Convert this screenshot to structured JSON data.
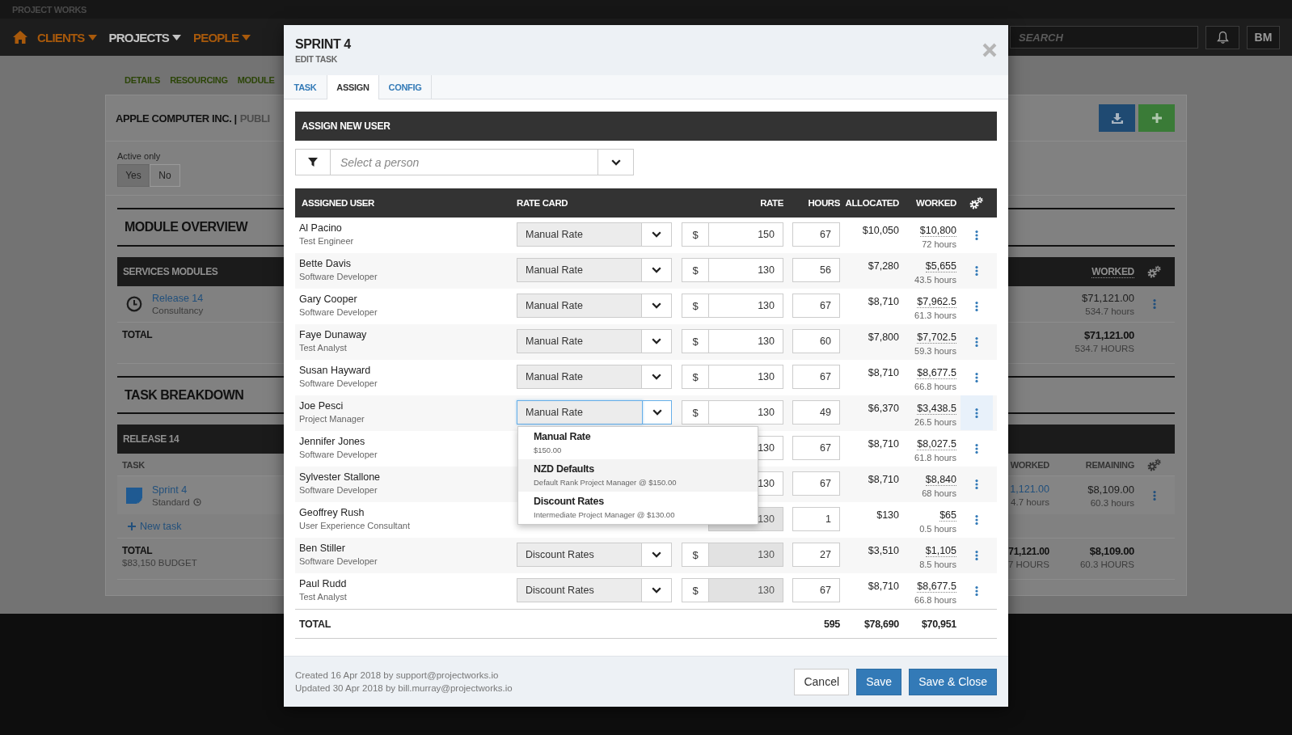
{
  "top_bar": {
    "brand": "PROJECT WORKS",
    "nav": [
      {
        "label": "CLIENTS",
        "selected": false
      },
      {
        "label": "PROJECTS",
        "selected": true
      },
      {
        "label": "PEOPLE",
        "selected": false
      }
    ],
    "search": {
      "placeholder": "SEARCH"
    },
    "user": "BM"
  },
  "page": {
    "tabs": [
      "DETAILS",
      "RESOURCING",
      "MODULE"
    ],
    "title": "APPLE COMPUTER INC. |",
    "subtitle": "PUBLI",
    "active_filter": {
      "label": "Active only",
      "options": [
        {
          "label": "Yes",
          "selected": true
        },
        {
          "label": "No",
          "selected": false
        }
      ]
    },
    "module_overview": {
      "title": "MODULE OVERVIEW",
      "group": "SERVICES MODULES",
      "column": "WORKED",
      "rows": [
        {
          "name": "Release 14",
          "type": "Consultancy",
          "worked": "$71,121.00",
          "hours": "534.7 hours"
        }
      ],
      "total": {
        "label": "TOTAL",
        "worked": "$71,121.00",
        "hours": "534.7 HOURS"
      }
    },
    "task_breakdown": {
      "title": "TASK BREAKDOWN",
      "group": "RELEASE 14",
      "columns": [
        "TASK",
        "WORKED",
        "REMAINING"
      ],
      "rows": [
        {
          "name": "Sprint 4",
          "type": "Standard",
          "worked": "1,121.00",
          "worked_hours": "4.7 hours",
          "remaining": "$8,109.00",
          "remaining_hours": "60.3 hours"
        }
      ],
      "new_task": "New task",
      "total": {
        "label": "TOTAL",
        "budget": "$83,150 BUDGET",
        "worked": "71,121.00",
        "worked_hours": "7 HOURS",
        "remaining": "$8,109.00",
        "remaining_hours": "60.3 HOURS"
      }
    }
  },
  "modal": {
    "title": "SPRINT 4",
    "subtitle": "EDIT TASK",
    "tabs": [
      {
        "label": "TASK",
        "selected": false
      },
      {
        "label": "ASSIGN",
        "selected": true
      },
      {
        "label": "CONFIG",
        "selected": false
      }
    ],
    "assign_title": "ASSIGN NEW USER",
    "person_select": {
      "placeholder": "Select a person"
    },
    "columns": [
      "ASSIGNED USER",
      "RATE CARD",
      "RATE",
      "HOURS",
      "ALLOCATED",
      "WORKED"
    ],
    "assignments": [
      {
        "name": "Al Pacino",
        "role": "Test Engineer",
        "rate_card": "Manual Rate",
        "open": false,
        "currency": "$",
        "rate": "150",
        "rate_locked": false,
        "hours": "67",
        "allocated": "$10,050",
        "worked": "$10,800",
        "worked_hours": "72 hours"
      },
      {
        "name": "Bette Davis",
        "role": "Software Developer",
        "rate_card": "Manual Rate",
        "open": false,
        "currency": "$",
        "rate": "130",
        "rate_locked": false,
        "hours": "56",
        "allocated": "$7,280",
        "worked": "$5,655",
        "worked_hours": "43.5 hours"
      },
      {
        "name": "Gary Cooper",
        "role": "Software Developer",
        "rate_card": "Manual Rate",
        "open": false,
        "currency": "$",
        "rate": "130",
        "rate_locked": false,
        "hours": "67",
        "allocated": "$8,710",
        "worked": "$7,962.5",
        "worked_hours": "61.3 hours"
      },
      {
        "name": "Faye Dunaway",
        "role": "Test Analyst",
        "rate_card": "Manual Rate",
        "open": false,
        "currency": "$",
        "rate": "130",
        "rate_locked": false,
        "hours": "60",
        "allocated": "$7,800",
        "worked": "$7,702.5",
        "worked_hours": "59.3 hours"
      },
      {
        "name": "Susan Hayward",
        "role": "Software Developer",
        "rate_card": "Manual Rate",
        "open": false,
        "currency": "$",
        "rate": "130",
        "rate_locked": false,
        "hours": "67",
        "allocated": "$8,710",
        "worked": "$8,677.5",
        "worked_hours": "66.8 hours"
      },
      {
        "name": "Joe Pesci",
        "role": "Project Manager",
        "rate_card": "Manual Rate",
        "open": true,
        "currency": "$",
        "rate": "130",
        "rate_locked": false,
        "hours": "49",
        "allocated": "$6,370",
        "worked": "$3,438.5",
        "worked_hours": "26.5 hours"
      },
      {
        "name": "Jennifer Jones",
        "role": "Software Developer",
        "rate": "130",
        "rate_locked": false,
        "hours": "67",
        "allocated": "$8,710",
        "worked": "$8,027.5",
        "worked_hours": "61.8 hours"
      },
      {
        "name": "Sylvester Stallone",
        "role": "Software Developer",
        "rate": "130",
        "rate_locked": false,
        "hours": "67",
        "allocated": "$8,710",
        "worked": "$8,840",
        "worked_hours": "68 hours"
      },
      {
        "name": "Geoffrey Rush",
        "role": "User Experience Consultant",
        "rate": "130",
        "rate_locked": true,
        "hours": "1",
        "allocated": "$130",
        "worked": "$65",
        "worked_hours": "0.5 hours"
      },
      {
        "name": "Ben Stiller",
        "role": "Software Developer",
        "rate_card": "Discount Rates",
        "open": false,
        "currency": "$",
        "rate": "130",
        "rate_locked": true,
        "hours": "27",
        "allocated": "$3,510",
        "worked": "$1,105",
        "worked_hours": "8.5 hours"
      },
      {
        "name": "Paul Rudd",
        "role": "Test Analyst",
        "rate_card": "Discount Rates",
        "open": false,
        "currency": "$",
        "rate": "130",
        "rate_locked": true,
        "hours": "67",
        "allocated": "$8,710",
        "worked": "$8,677.5",
        "worked_hours": "66.8 hours"
      }
    ],
    "total": {
      "label": "TOTAL",
      "hours": "595",
      "allocated": "$78,690",
      "worked": "$70,951"
    },
    "rate_card_menu": [
      {
        "title": "Manual Rate",
        "detail": "$150.00",
        "selected": false
      },
      {
        "title": "NZD Defaults",
        "detail": "Default Rank Project Manager @ $150.00",
        "selected": true
      },
      {
        "title": "Discount Rates",
        "detail": "Intermediate Project Manager @ $130.00",
        "selected": false
      }
    ],
    "footer": {
      "created": "Created 16 Apr 2018 by support@projectworks.io",
      "updated": "Updated 30 Apr 2018 by bill.murray@projectworks.io"
    },
    "buttons": [
      {
        "label": "Cancel",
        "kind": "secondary"
      },
      {
        "label": "Save",
        "kind": "primary"
      },
      {
        "label": "Save & Close",
        "kind": "primary"
      }
    ]
  }
}
